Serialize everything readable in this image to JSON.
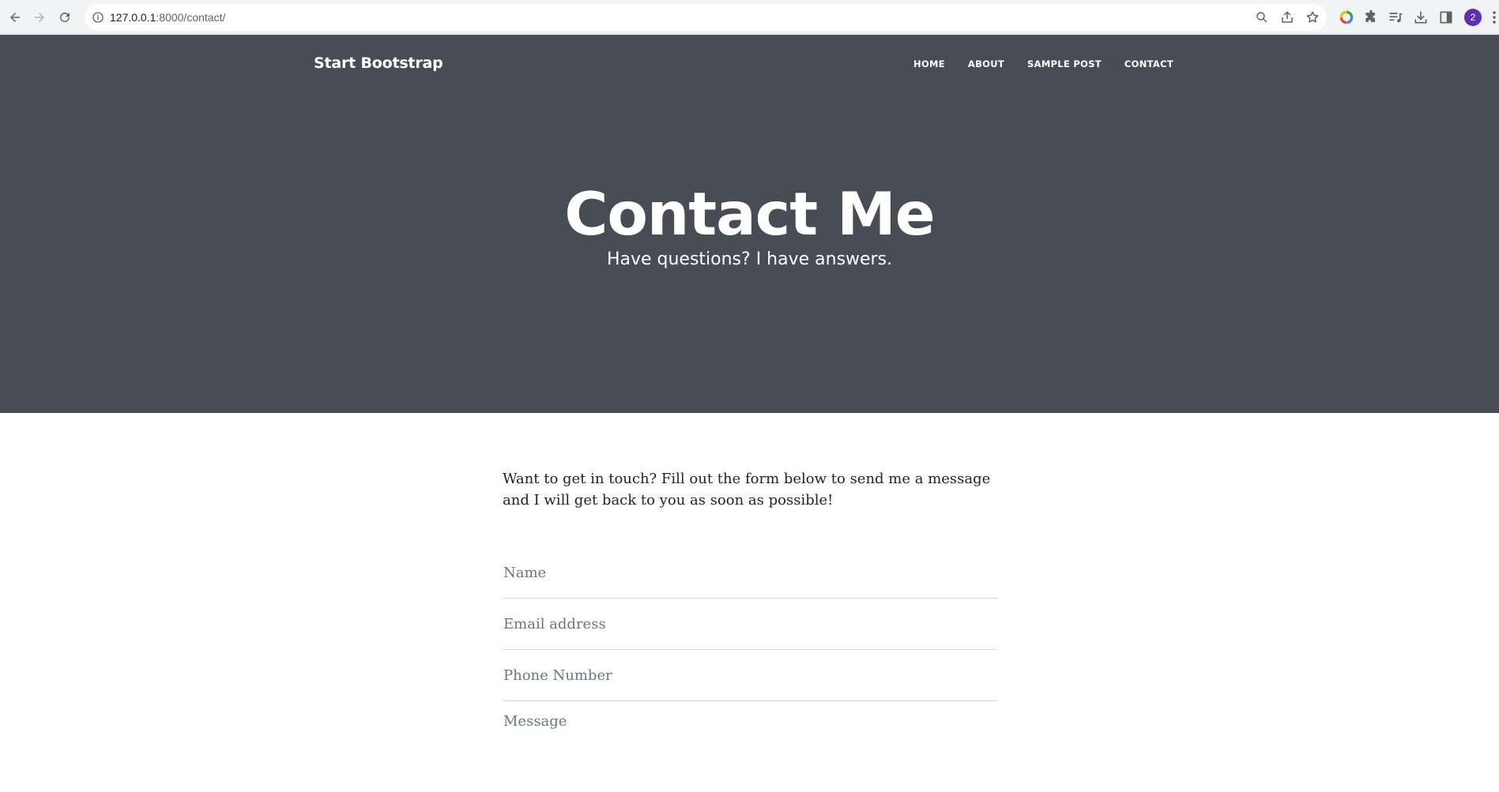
{
  "browser": {
    "url_host": "127.0.0.1",
    "url_path": ":8000/contact/",
    "profile_badge": "2"
  },
  "navbar": {
    "brand": "Start Bootstrap",
    "links": [
      "HOME",
      "ABOUT",
      "SAMPLE POST",
      "CONTACT"
    ]
  },
  "hero": {
    "title": "Contact Me",
    "subtitle": "Have questions? I have answers."
  },
  "content": {
    "intro": "Want to get in touch? Fill out the form below to send me a message and I will get back to you as soon as possible!"
  },
  "form": {
    "name_placeholder": "Name",
    "email_placeholder": "Email address",
    "phone_placeholder": "Phone Number",
    "message_placeholder": "Message"
  },
  "colors": {
    "masthead_bg": "#484c54",
    "avatar_bg": "#5b2fb3"
  }
}
